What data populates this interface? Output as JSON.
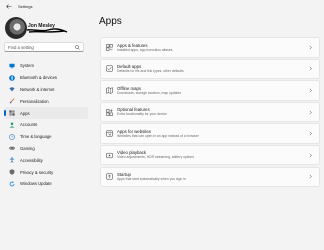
{
  "window": {
    "title": "Settings"
  },
  "profile": {
    "name": "Jon Mesley"
  },
  "search": {
    "placeholder": "Find a setting"
  },
  "nav": {
    "items": [
      {
        "label": "System",
        "icon": "monitor-icon"
      },
      {
        "label": "Bluetooth & devices",
        "icon": "bluetooth-icon"
      },
      {
        "label": "Network & internet",
        "icon": "wifi-icon"
      },
      {
        "label": "Personalization",
        "icon": "paintbrush-icon"
      },
      {
        "label": "Apps",
        "icon": "apps-icon",
        "active": true
      },
      {
        "label": "Accounts",
        "icon": "person-icon"
      },
      {
        "label": "Time & language",
        "icon": "globe-clock-icon"
      },
      {
        "label": "Gaming",
        "icon": "gamepad-icon"
      },
      {
        "label": "Accessibility",
        "icon": "accessibility-icon"
      },
      {
        "label": "Privacy & security",
        "icon": "shield-icon"
      },
      {
        "label": "Windows Update",
        "icon": "update-icon"
      }
    ]
  },
  "main": {
    "title": "Apps",
    "cards": [
      {
        "title": "Apps & features",
        "subtitle": "Installed apps, app execution aliases",
        "icon": "apps-features-icon"
      },
      {
        "title": "Default apps",
        "subtitle": "Defaults for file and link types, other defaults",
        "icon": "default-apps-icon"
      },
      {
        "title": "Offline maps",
        "subtitle": "Downloads, storage location, map updates",
        "icon": "map-icon"
      },
      {
        "title": "Optional features",
        "subtitle": "Extra functionality for your device",
        "icon": "optional-features-icon"
      },
      {
        "title": "Apps for websites",
        "subtitle": "Websites that can open in an app instead of a browser",
        "icon": "apps-websites-icon"
      },
      {
        "title": "Video playback",
        "subtitle": "Video adjustments, HDR streaming, battery options",
        "icon": "video-icon"
      },
      {
        "title": "Startup",
        "subtitle": "Apps that start automatically when you sign in",
        "icon": "startup-icon"
      }
    ]
  },
  "colors": {
    "accent": "#0067c0",
    "background": "#f3f3f3",
    "card": "#fbfbfb"
  }
}
